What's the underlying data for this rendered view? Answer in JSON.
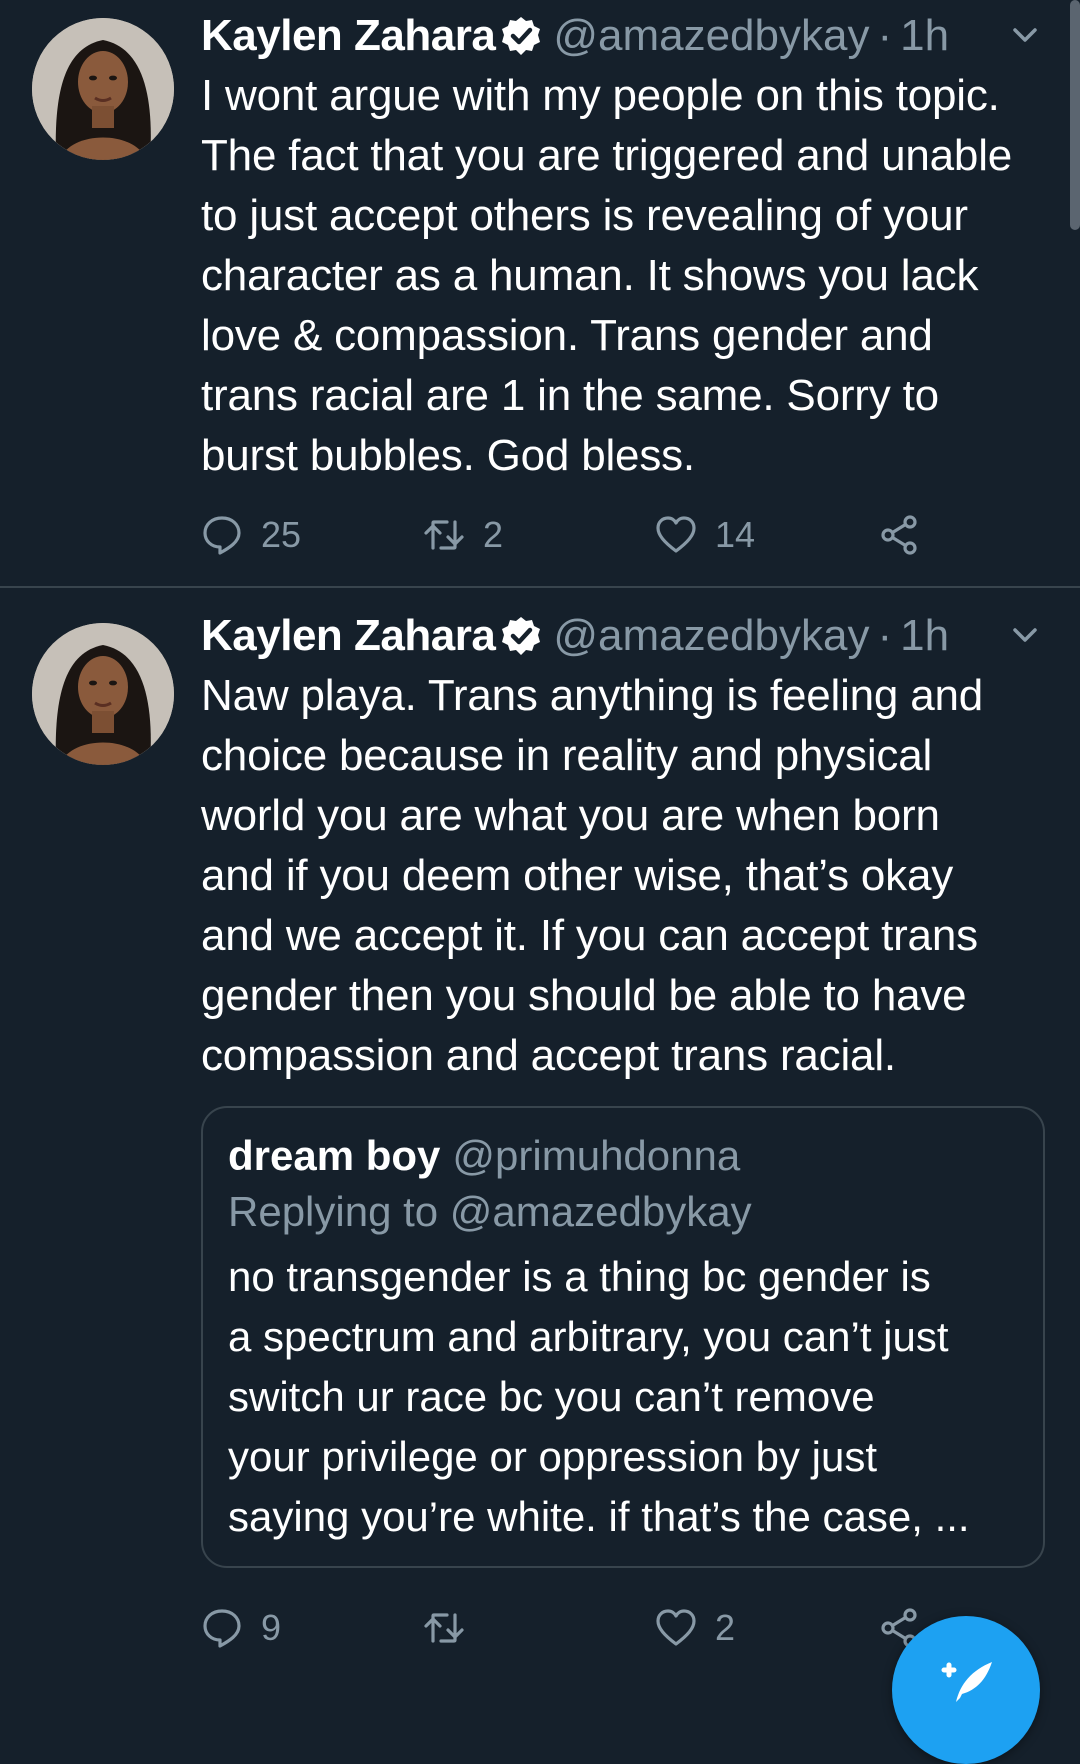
{
  "tweets": [
    {
      "author": {
        "name": "Kaylen Zahara",
        "handle": "@amazedbykay",
        "verified": true
      },
      "separator": "·",
      "time": "1h",
      "text": "I wont argue with my people on this topic.\nThe fact that you are triggered and unable\nto just accept others is revealing of your\ncharacter as a human. It shows you lack\nlove & compassion. Trans gender and\ntrans racial are 1 in the same. Sorry to\nburst bubbles. God bless.",
      "actions": {
        "replies": "25",
        "retweets": "2",
        "likes": "14"
      }
    },
    {
      "author": {
        "name": "Kaylen Zahara",
        "handle": "@amazedbykay",
        "verified": true
      },
      "separator": "·",
      "time": "1h",
      "text": "Naw playa. Trans anything is feeling and\nchoice because in reality and physical\nworld you are what you are when born\nand if you deem other wise, that’s okay\nand we accept it. If you can accept trans\ngender then you should be able to have\ncompassion and accept trans racial.",
      "quote": {
        "name": "dream boy",
        "handle": "@primuhdonna",
        "replying_to": "Replying to @amazedbykay",
        "text": "no transgender is a thing bc gender is\na spectrum and arbitrary, you can’t just\nswitch ur race bc you can’t remove\nyour privilege or oppression by just\nsaying you’re white. if that’s the case, ..."
      },
      "actions": {
        "replies": "9",
        "retweets": "",
        "likes": "2"
      }
    }
  ],
  "icons": {
    "verified": "verified-badge-icon",
    "caret": "chevron-down-icon",
    "reply": "reply-bubble-icon",
    "retweet": "retweet-icon",
    "like": "heart-icon",
    "share": "share-icon",
    "compose": "compose-tweet-icon"
  },
  "colors": {
    "background": "#15202b",
    "secondary_text": "#8899a6",
    "divider": "#38444d",
    "accent": "#1da1f2"
  }
}
